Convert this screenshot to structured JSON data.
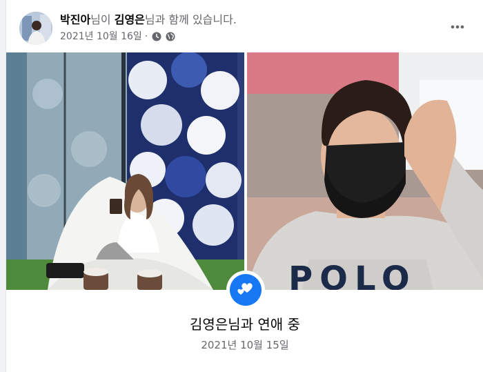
{
  "post": {
    "author": "박진아",
    "author_suffix": "님이",
    "tagged": "김영은",
    "tagged_suffix": "님과 함께 있습니다.",
    "date": "2021년 10월 16일",
    "separator": "·",
    "more_icon": "more-horizontal-icon",
    "meta_icons": [
      "clock-icon",
      "globe-icon"
    ]
  },
  "life_event": {
    "title": "김영은님과 연애 중",
    "date": "2021년 10월 15일",
    "icon": "hearts-icon",
    "accent_color": "#1877f2"
  }
}
